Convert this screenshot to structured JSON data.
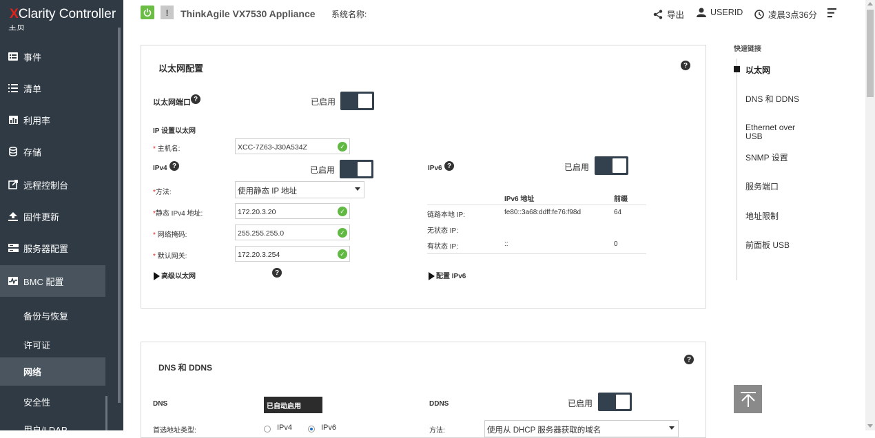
{
  "app": {
    "logo_x": "X",
    "logo_rest": "Clarity Controller"
  },
  "sidebar": {
    "cut_item": "主页",
    "items": [
      {
        "label": "事件",
        "icon": "events-icon"
      },
      {
        "label": "清单",
        "icon": "list-icon"
      },
      {
        "label": "利用率",
        "icon": "utilization-icon"
      },
      {
        "label": "存储",
        "icon": "storage-icon"
      },
      {
        "label": "远程控制台",
        "icon": "remote-console-icon"
      },
      {
        "label": "固件更新",
        "icon": "firmware-upload-icon"
      },
      {
        "label": "服务器配置",
        "icon": "server-config-icon"
      },
      {
        "label": "BMC 配置",
        "icon": "bmc-config-icon"
      }
    ],
    "subitems": [
      {
        "label": "备份与恢复"
      },
      {
        "label": "许可证"
      },
      {
        "label": "网络"
      },
      {
        "label": "安全性"
      },
      {
        "label": "用户/LDAP"
      }
    ]
  },
  "topbar": {
    "product": "ThinkAgile VX7530 Appliance",
    "system_name_label": "系统名称:",
    "export": "导出",
    "user": "USERID",
    "time": "凌晨3点36分"
  },
  "ethernet": {
    "title": "以太网配置",
    "port_label": "以太网端口",
    "enabled": "已启用",
    "ip_settings": "IP 设置以太网",
    "hostname_label": "主机名:",
    "hostname": "XCC-7Z63-J30A534Z",
    "ipv4": "IPv4",
    "ipv6": "IPv6",
    "method_label": "方法:",
    "method_value": "使用静态 IP 地址",
    "static_ipv4_label": "静态 IPv4 地址:",
    "static_ipv4": "172.20.3.20",
    "netmask_label": "网络掩码:",
    "netmask": "255.255.255.0",
    "gateway_label": "默认网关:",
    "gateway": "172.20.3.254",
    "advanced": "高级以太网",
    "config_ipv6": "配置 IPv6",
    "ipv6_table": {
      "headers": [
        "IPv6 地址",
        "前缀"
      ],
      "rows": [
        {
          "label": "链路本地 IP:",
          "addr": "fe80::3a68:ddff:fe76:f98d",
          "prefix": "64"
        },
        {
          "label": "无状态 IP:",
          "addr": "",
          "prefix": ""
        },
        {
          "label": "有状态 IP:",
          "addr": "::",
          "prefix": "0"
        }
      ]
    }
  },
  "dns": {
    "title": "DNS 和 DDNS",
    "dns_label": "DNS",
    "auto_badge": "已自动启用",
    "ddns_label": "DDNS",
    "ddns_enabled": "已启用",
    "pref_label": "首选地址类型:",
    "opt_ipv4": "IPv4",
    "opt_ipv6": "IPv6",
    "method_label": "方法:",
    "method_value": "使用从 DHCP 服务器获取的域名"
  },
  "quicklinks": {
    "title": "快速链接",
    "items": [
      "以太网",
      "DNS 和 DDNS",
      "Ethernet over USB",
      "SNMP 设置",
      "服务端口",
      "地址限制",
      "前面板 USB"
    ]
  },
  "colors": {
    "sidebar_bg": "#2f3a44",
    "toggle_bg": "#33414e",
    "power_green": "#6cbd45",
    "check_green": "#61b944",
    "brand_red": "#e2231a"
  }
}
